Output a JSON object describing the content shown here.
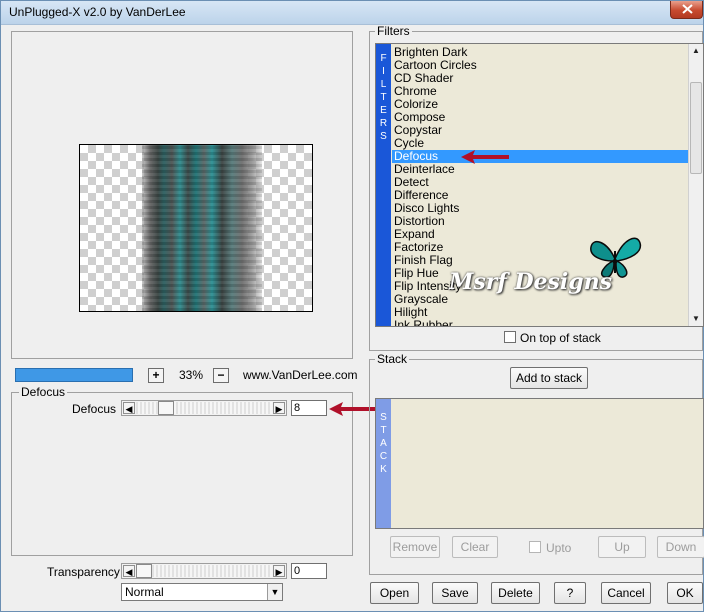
{
  "window": {
    "title": "UnPlugged-X v2.0 by VanDerLee"
  },
  "preview": {
    "zoom": "33%",
    "plus": "+",
    "minus": "−",
    "url": "www.VanDerLee.com"
  },
  "defocus_group": {
    "caption": "Defocus",
    "param_label": "Defocus",
    "value": "8",
    "slider_fraction": 0.27
  },
  "transparency": {
    "label": "Transparency",
    "value": "0",
    "slider_fraction": 0.0
  },
  "blend": {
    "selected": "Normal"
  },
  "filters": {
    "caption": "Filters",
    "vertical_label": [
      "F",
      "I",
      "L",
      "T",
      "E",
      "R",
      "S"
    ],
    "items": [
      "Brighten Dark",
      "Cartoon Circles",
      "CD Shader",
      "Chrome",
      "Colorize",
      "Compose",
      "Copystar",
      "Cycle",
      "Defocus",
      "Deinterlace",
      "Detect",
      "Difference",
      "Disco Lights",
      "Distortion",
      "Expand",
      "Factorize",
      "Finish Flag",
      "Flip Hue",
      "Flip Intensity",
      "Grayscale",
      "Hilight",
      "Ink Rubber"
    ],
    "selected_index": 8,
    "watermark": "Msrf Designs",
    "on_top_label": "On top of stack"
  },
  "stack": {
    "caption": "Stack",
    "add_button": "Add to stack",
    "vertical_label": [
      "S",
      "T",
      "A",
      "C",
      "K"
    ],
    "remove": "Remove",
    "clear": "Clear",
    "upto": "Upto",
    "up": "Up",
    "down": "Down"
  },
  "footer": {
    "open": "Open",
    "save": "Save",
    "delete": "Delete",
    "help": "?",
    "cancel": "Cancel",
    "ok": "OK"
  },
  "colors": {
    "selection": "#3399ff",
    "filter_bar": "#1a57d8",
    "stack_bar": "#7f9ce6",
    "arrow_red": "#b0102a"
  }
}
